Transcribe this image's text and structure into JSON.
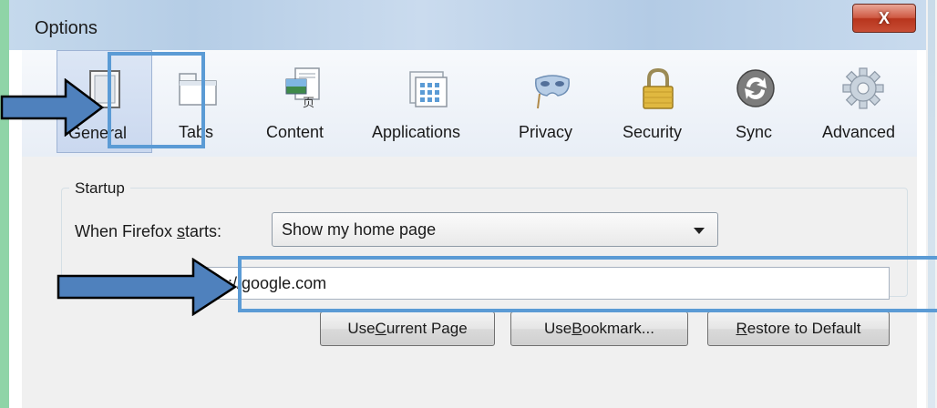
{
  "window": {
    "title": "Options",
    "close_glyph": "X"
  },
  "toolbar": {
    "tabs": [
      {
        "label": "General",
        "icon": "general-icon"
      },
      {
        "label": "Tabs",
        "icon": "tabs-icon"
      },
      {
        "label": "Content",
        "icon": "content-icon"
      },
      {
        "label": "Applications",
        "icon": "applications-icon"
      },
      {
        "label": "Privacy",
        "icon": "privacy-mask-icon"
      },
      {
        "label": "Security",
        "icon": "padlock-icon"
      },
      {
        "label": "Sync",
        "icon": "sync-icon"
      },
      {
        "label": "Advanced",
        "icon": "gear-icon"
      }
    ],
    "selected": "General"
  },
  "startup": {
    "legend": "Startup",
    "when_label_prefix": "When Firefox ",
    "when_label_accel": "s",
    "when_label_suffix": "tarts:",
    "dropdown_value": "Show my home page",
    "homepage_value": "http://google.com",
    "buttons": {
      "use_current_prefix": "Use ",
      "use_current_accel": "C",
      "use_current_suffix": "urrent Page",
      "use_bookmark_prefix": "Use ",
      "use_bookmark_accel": "B",
      "use_bookmark_suffix": "ookmark...",
      "restore_accel": "R",
      "restore_suffix": "estore to Default"
    }
  },
  "colors": {
    "annotation": "#5b9bd5",
    "annotation_arrow_fill": "#4f81bd",
    "close_button": "#c74d35",
    "selected_tab": "#cad8ef"
  }
}
